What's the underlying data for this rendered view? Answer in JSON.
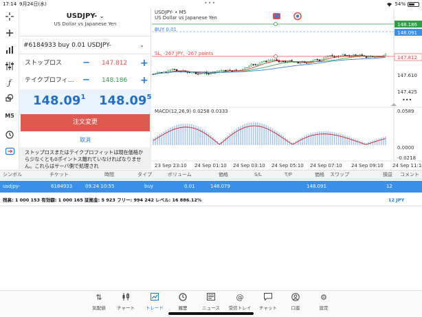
{
  "status_bar": {
    "time": "17:14",
    "date": "9月24日(水)",
    "battery": "54%"
  },
  "left_toolbar": {
    "m5_label": "M5"
  },
  "order_panel": {
    "symbol": "USDJPY-",
    "symbol_desc": "US Dollar vs Japanese Yen",
    "order_select": "#6184933 buy 0.01 USDJPY-",
    "stop_loss_label": "ストップロス",
    "stop_loss_value": "147.812",
    "take_profit_label": "テイクプロフィ…",
    "take_profit_value": "148.186",
    "minus": "−",
    "plus": "+",
    "bid_main": "148.09",
    "bid_sup": "1",
    "ask_main": "148.09",
    "ask_sup": "5",
    "modify_button": "注文変更",
    "cancel_button": "取消",
    "note": "ストップロスまたはテイクプロフィットは現在価格から少なくとも0ポイントス離れていなければなりません。これらはサーバ側で処理され"
  },
  "chart": {
    "header_symbol": "USDJPY- • M5",
    "header_desc": "US Dollar vs Japanese Yen",
    "buy_line_label": "BUY 0.01",
    "sl_line_label": "SL, -267 JPY, -267 points",
    "price_labels": {
      "tp": "148.186",
      "current": "148.091",
      "sl": "147.812",
      "p1": "147.610",
      "p2": "147.425"
    },
    "macd_label": "MACD(12,26,9) 0.0258 0.0333",
    "macd_labels": {
      "top": "0.0589",
      "mid": "0.0000",
      "bottom": "-0.0218"
    },
    "time_labels": [
      "23 Sep 23:10",
      "24 Sep 01:10",
      "24 Sep 03:10",
      "24 Sep 05:10",
      "24 Sep 07:10",
      "24 Sep 09:10",
      "24 Sep 11:10"
    ],
    "more": "•••",
    "colors": {
      "tp_line": "#2e9e44",
      "sl_line": "#e04c4c",
      "buy_line": "#3a7be0",
      "bull": "#1e9e3a",
      "bear": "#111111",
      "macd_hist": "#a9c8f0",
      "macd_signal": "#d42020"
    }
  },
  "trade_table": {
    "headers": [
      "シンボル",
      "チケット",
      "時間",
      "タイプ",
      "ボリューム",
      "価格",
      "S/L",
      "T/P",
      "価格",
      "スワップ",
      "損益",
      "コメント"
    ],
    "row": {
      "symbol": "usdjpy-",
      "ticket": "6184933",
      "time": "09.24 10:55",
      "type": "buy",
      "volume": "0.01",
      "price": "148.079",
      "sl": "",
      "tp": "",
      "cur_price": "148.091",
      "swap": "",
      "profit": "12",
      "comment": ""
    },
    "balance": "残高: 1 000 153 有効額: 1 000 165 証拠金: 5 923 フリー: 994 242 レベル: 16 886.12%",
    "total_profit": "12  JPY"
  },
  "bottom_nav": [
    {
      "label": "気配値",
      "icon": "quotes-icon"
    },
    {
      "label": "チャート",
      "icon": "chart-icon"
    },
    {
      "label": "トレード",
      "icon": "trade-icon",
      "active": true
    },
    {
      "label": "履歴",
      "icon": "history-icon"
    },
    {
      "label": "ニュース",
      "icon": "news-icon"
    },
    {
      "label": "受信トレイ",
      "icon": "inbox-icon"
    },
    {
      "label": "チャット",
      "icon": "chat-icon"
    },
    {
      "label": "口座",
      "icon": "account-icon"
    },
    {
      "label": "設定",
      "icon": "settings-icon"
    }
  ]
}
